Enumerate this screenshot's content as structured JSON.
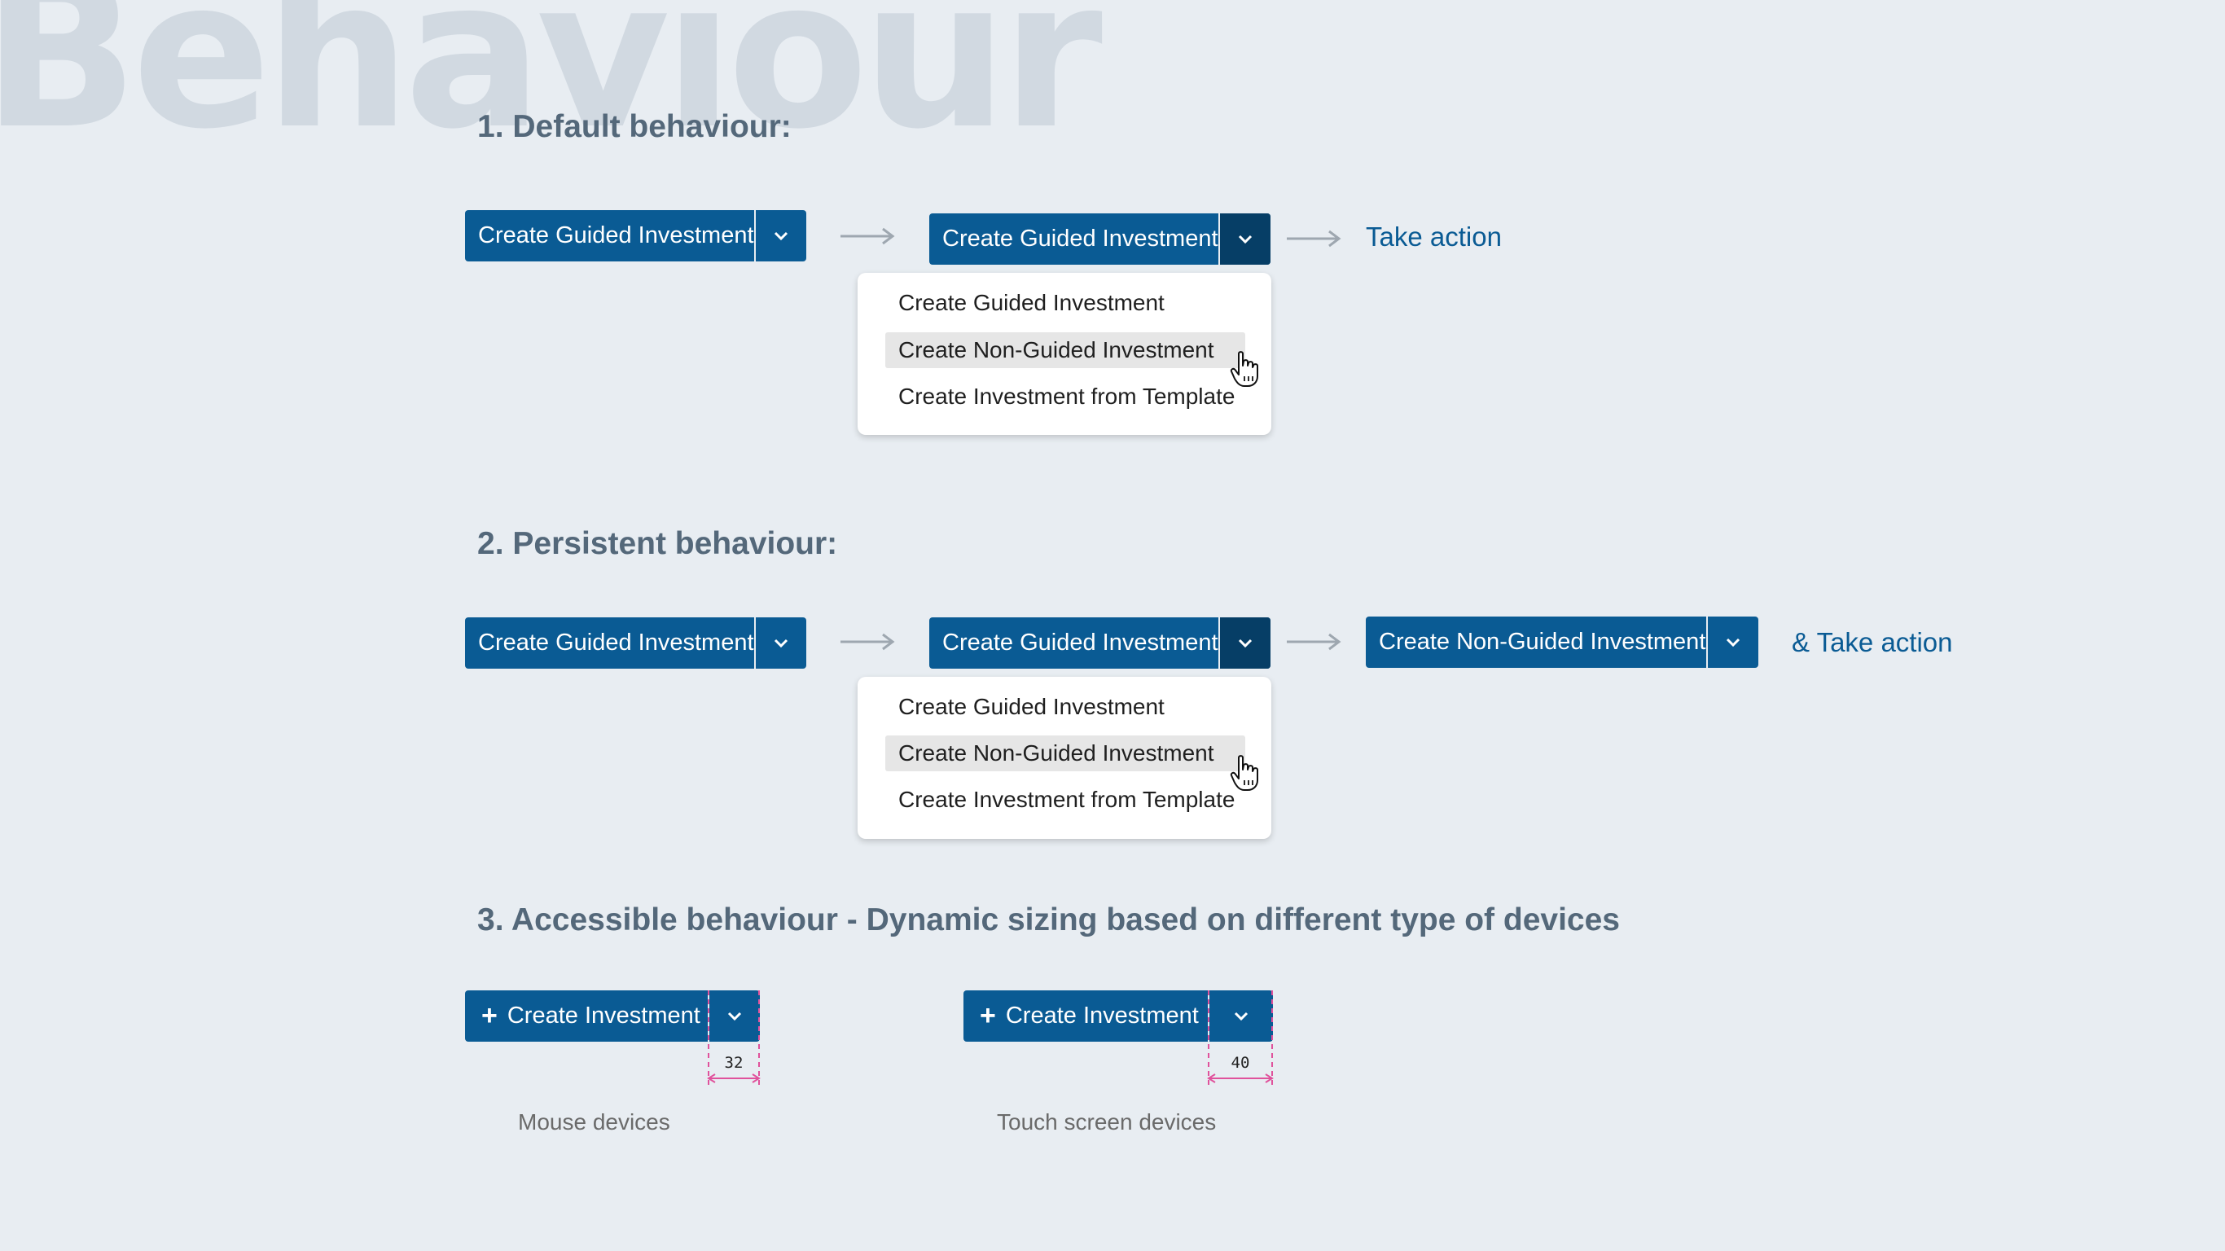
{
  "background_title": "Behaviour",
  "sections": [
    {
      "number": "1.",
      "title": "Default behaviour:",
      "button_label": "Create Guided Investment",
      "menu_items": [
        "Create Guided Investment",
        "Create Non-Guided Investment",
        "Create Investment from Template"
      ],
      "result_text": "Take action"
    },
    {
      "number": "2.",
      "title": "Persistent behaviour:",
      "button_label": "Create Guided Investment",
      "menu_items": [
        "Create Guided Investment",
        "Create Non-Guided Investment",
        "Create Investment from Template"
      ],
      "result_button_label": "Create Non-Guided Investment",
      "result_text": "& Take action"
    },
    {
      "number": "3.",
      "title": "Accessible behaviour  - Dynamic sizing based on different type of devices",
      "mouse": {
        "button_label": "Create Investment",
        "width_label": "32",
        "caption": "Mouse devices"
      },
      "touch": {
        "button_label": "Create Investment",
        "width_label": "40",
        "caption": "Touch screen devices"
      }
    }
  ],
  "icons": {
    "dropdown": "chevron-down-icon",
    "plus": "plus-icon",
    "arrow": "arrow-right-icon",
    "cursor": "hand-pointer-icon"
  },
  "colors": {
    "primary": "#0a5b94",
    "primary_active": "#063e66",
    "heading": "#54687a",
    "background": "#e8edf2",
    "watermark": "#d1d9e1",
    "measure": "#e0529c"
  }
}
